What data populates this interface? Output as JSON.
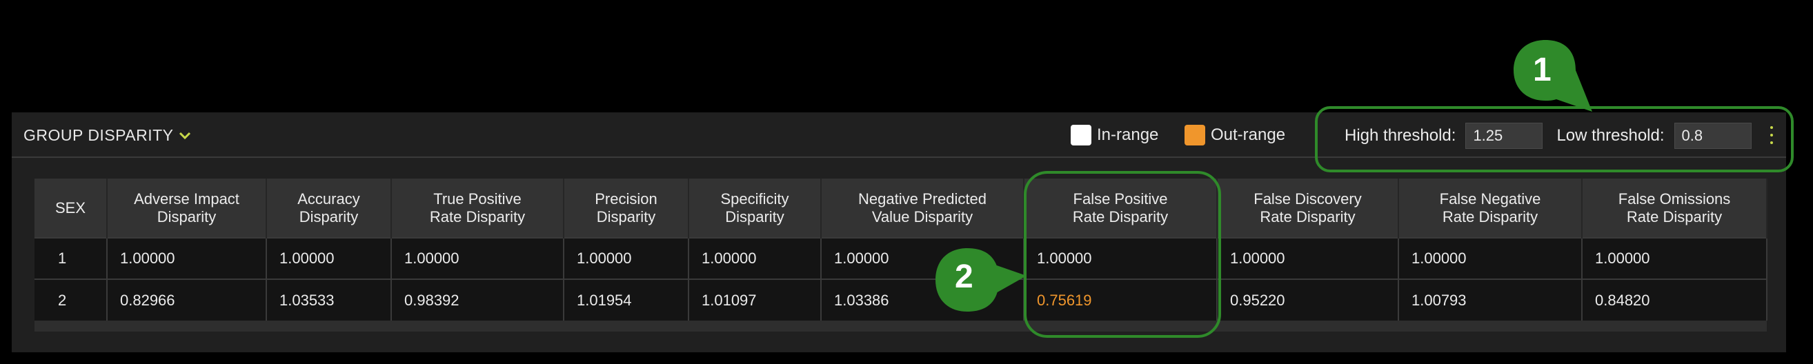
{
  "panel": {
    "title": "GROUP DISPARITY",
    "title_icon": "chevron-down-icon",
    "legend": [
      {
        "label": "In-range",
        "color": "#ffffff"
      },
      {
        "label": "Out-range",
        "color": "#f0962c"
      }
    ],
    "thresholds": {
      "high_label": "High threshold:",
      "high_value": "1.25",
      "low_label": "Low threshold:",
      "low_value": "0.8",
      "menu_icon": "kebab-menu-icon"
    }
  },
  "table": {
    "headers": [
      [
        "SEX"
      ],
      [
        "Adverse Impact",
        "Disparity"
      ],
      [
        "Accuracy",
        "Disparity"
      ],
      [
        "True Positive",
        "Rate Disparity"
      ],
      [
        "Precision",
        "Disparity"
      ],
      [
        "Specificity",
        "Disparity"
      ],
      [
        "Negative Predicted",
        "Value Disparity"
      ],
      [
        "False Positive",
        "Rate Disparity"
      ],
      [
        "False Discovery",
        "Rate Disparity"
      ],
      [
        "False Negative",
        "Rate Disparity"
      ],
      [
        "False Omissions",
        "Rate Disparity"
      ]
    ],
    "rows": [
      [
        "1",
        "1.00000",
        "1.00000",
        "1.00000",
        "1.00000",
        "1.00000",
        "1.00000",
        "1.00000",
        "1.00000",
        "1.00000",
        "1.00000"
      ],
      [
        "2",
        "0.82966",
        "1.03533",
        "0.98392",
        "1.01954",
        "1.01097",
        "1.03386",
        "0.75619",
        "0.95220",
        "1.00793",
        "0.84820"
      ]
    ],
    "out_of_range": [
      [
        1,
        7
      ]
    ]
  },
  "annotations": {
    "callout_1": "1",
    "callout_2": "2",
    "color": "#2f8a2a"
  }
}
